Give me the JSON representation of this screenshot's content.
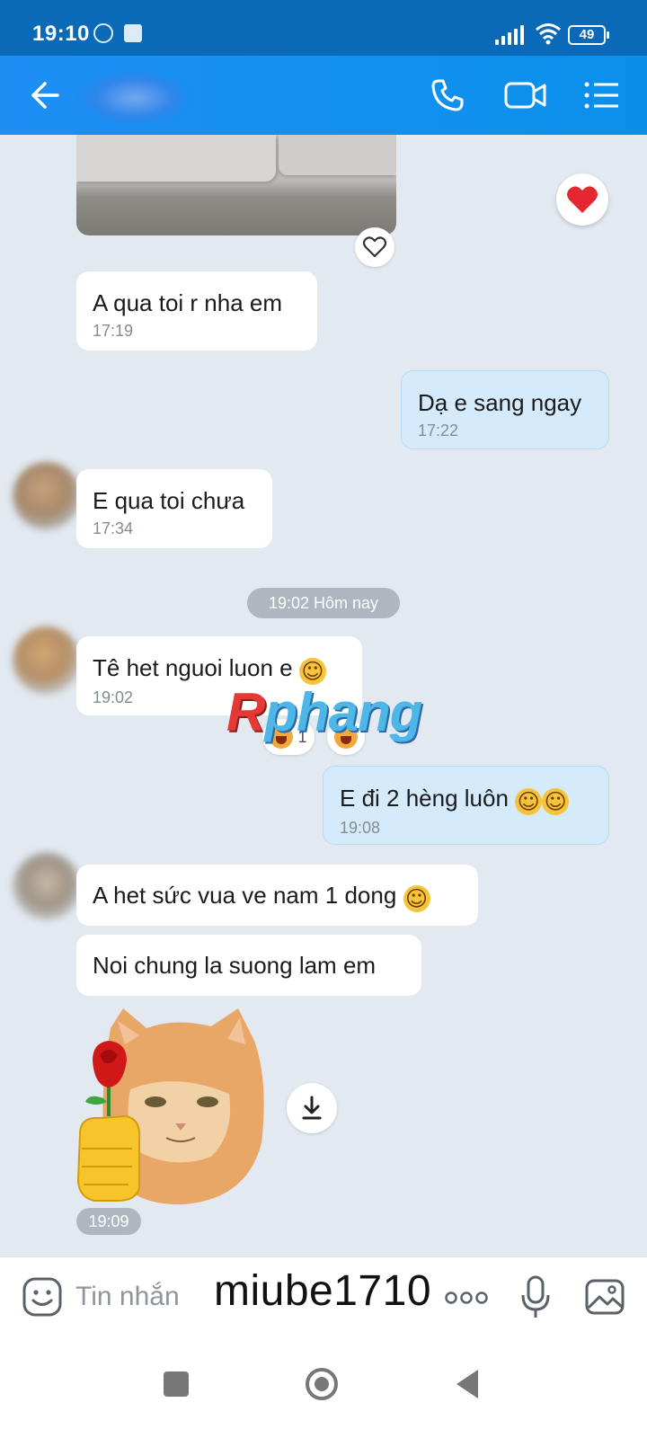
{
  "status_bar": {
    "time": "19:10",
    "battery": "49"
  },
  "messages": [
    {
      "id": "m1",
      "text": "A qua toi r nha em",
      "time": "17:19"
    },
    {
      "id": "m2",
      "text": "Dạ e sang ngay",
      "time": "17:22"
    },
    {
      "id": "m3",
      "text": "E qua toi chưa",
      "time": "17:34"
    },
    {
      "id": "m4",
      "text": "Tê het nguoi luon e",
      "time": "19:02",
      "reaction_count": "1"
    },
    {
      "id": "m5",
      "text": "E đi 2 hèng luôn",
      "time": "19:08"
    },
    {
      "id": "m6",
      "text": "A het sức vua ve nam 1 dong"
    },
    {
      "id": "m7",
      "text": "Noi chung la suong lam em"
    }
  ],
  "date_separator": "19:02 Hôm nay",
  "sticker_time": "19:09",
  "watermark": {
    "first": "R",
    "rest": "phang"
  },
  "input": {
    "placeholder": "Tin nhắn"
  },
  "overlay_text": "miube1710",
  "colors": {
    "header": "#1e8ef5",
    "sent_bubble": "#d5ebfc",
    "received_bubble": "#ffffff",
    "background": "#e2e9f1"
  },
  "icons": [
    "back-arrow-icon",
    "phone-icon",
    "video-camera-icon",
    "list-menu-icon",
    "heart-icon",
    "download-icon",
    "sticker-face-icon",
    "more-dots-icon",
    "microphone-icon",
    "image-icon"
  ]
}
